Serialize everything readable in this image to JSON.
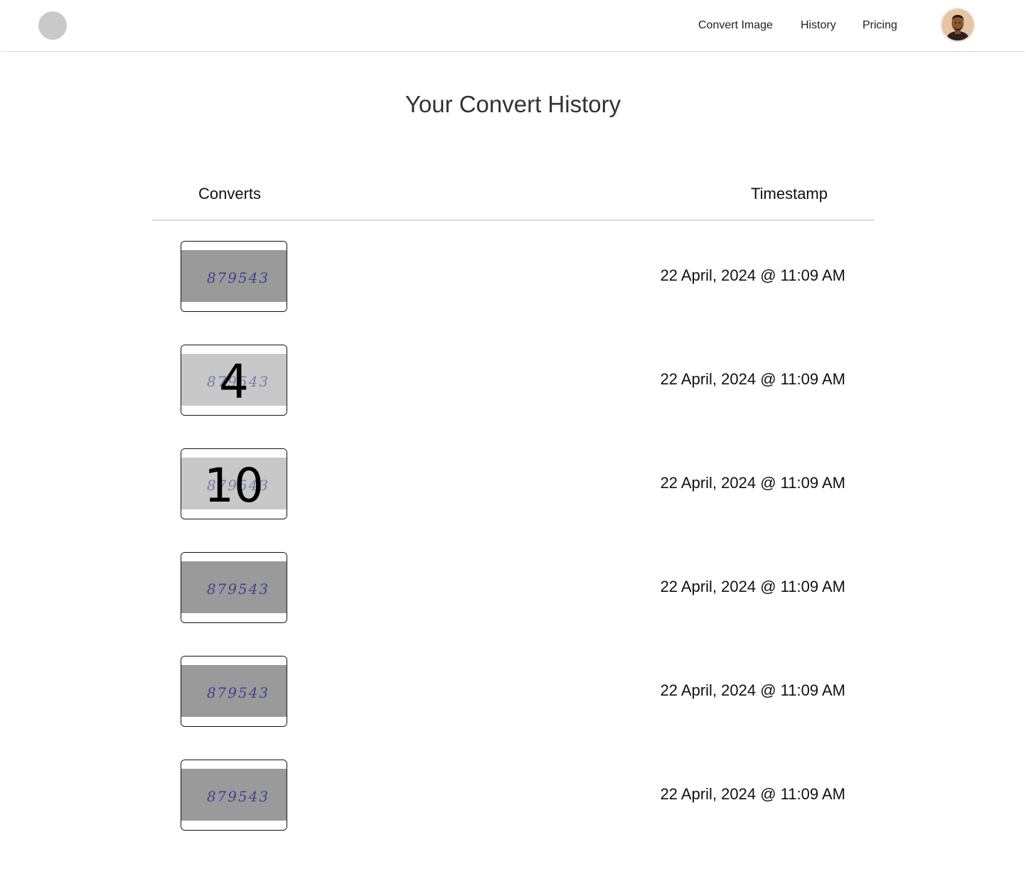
{
  "nav": {
    "links": [
      "Convert Image",
      "History",
      "Pricing"
    ]
  },
  "page": {
    "title": "Your Convert History"
  },
  "table": {
    "headers": [
      "Converts",
      "Timestamp"
    ],
    "rows": [
      {
        "handwritten": "879543",
        "overlay": "",
        "timestamp": "22 April, 2024 @ 11:09 AM",
        "tone": "dark"
      },
      {
        "handwritten": "879543",
        "overlay": "4",
        "timestamp": "22 April, 2024 @ 11:09 AM",
        "tone": "light"
      },
      {
        "handwritten": "879543",
        "overlay": "10",
        "timestamp": "22 April, 2024 @ 11:09 AM",
        "tone": "light"
      },
      {
        "handwritten": "879543",
        "overlay": "",
        "timestamp": "22 April, 2024 @ 11:09 AM",
        "tone": "dark"
      },
      {
        "handwritten": "879543",
        "overlay": "",
        "timestamp": "22 April, 2024 @ 11:09 AM",
        "tone": "dark"
      },
      {
        "handwritten": "879543",
        "overlay": "",
        "timestamp": "22 April, 2024 @ 11:09 AM",
        "tone": "dark"
      }
    ]
  },
  "colors": {
    "logo": "#c9c9c9",
    "divider": "#d9d9d9",
    "ink": "#3a3d8c",
    "paper_dark": "#9a9a9a",
    "paper_light": "#c8c8c8"
  }
}
